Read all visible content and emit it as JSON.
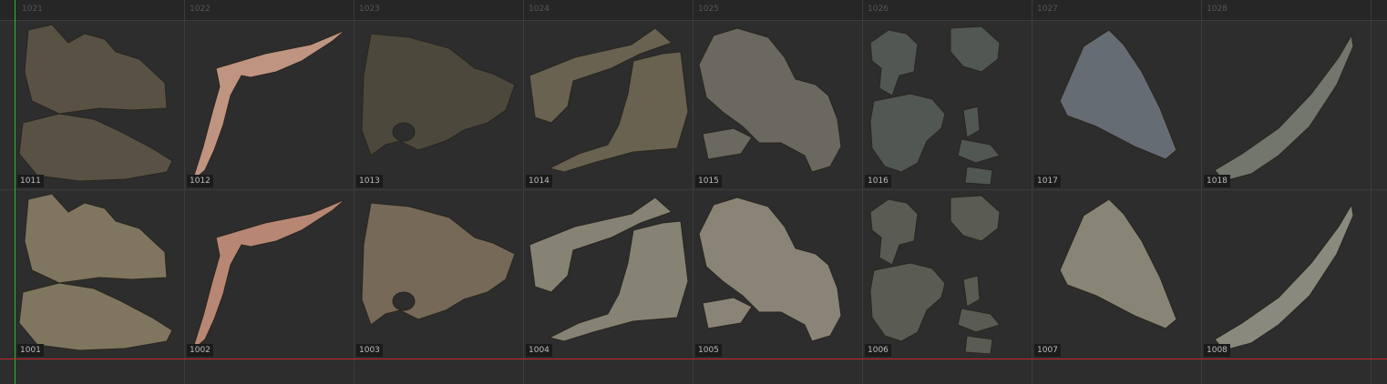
{
  "column_labels": [
    "1021",
    "1022",
    "1023",
    "1024",
    "1025",
    "1026",
    "1027",
    "1028"
  ],
  "rows": [
    {
      "tiles": [
        {
          "label": "1011",
          "shape": "blob-pair",
          "color": "#5c5546"
        },
        {
          "label": "1012",
          "shape": "flesh-hook",
          "color": "#c79a86"
        },
        {
          "label": "1013",
          "shape": "wedge-hole",
          "color": "#4e4a3c"
        },
        {
          "label": "1014",
          "shape": "strips",
          "color": "#6d6553"
        },
        {
          "label": "1015",
          "shape": "bag",
          "color": "#6f6c62"
        },
        {
          "label": "1016",
          "shape": "cluster",
          "color": "#535a55"
        },
        {
          "label": "1017",
          "shape": "fan",
          "color": "#6a7078"
        },
        {
          "label": "1018",
          "shape": "blade",
          "color": "#767a70"
        }
      ]
    },
    {
      "tiles": [
        {
          "label": "1001",
          "shape": "blob-pair",
          "color": "#857a62"
        },
        {
          "label": "1002",
          "shape": "flesh-hook",
          "color": "#c08c78"
        },
        {
          "label": "1003",
          "shape": "wedge-hole",
          "color": "#7a6d5a"
        },
        {
          "label": "1004",
          "shape": "strips",
          "color": "#8c8878"
        },
        {
          "label": "1005",
          "shape": "bag",
          "color": "#8f897b"
        },
        {
          "label": "1006",
          "shape": "cluster",
          "color": "#5d5e54"
        },
        {
          "label": "1007",
          "shape": "fan",
          "color": "#8d8a7a"
        },
        {
          "label": "1008",
          "shape": "blade",
          "color": "#8f8e82"
        }
      ]
    }
  ]
}
